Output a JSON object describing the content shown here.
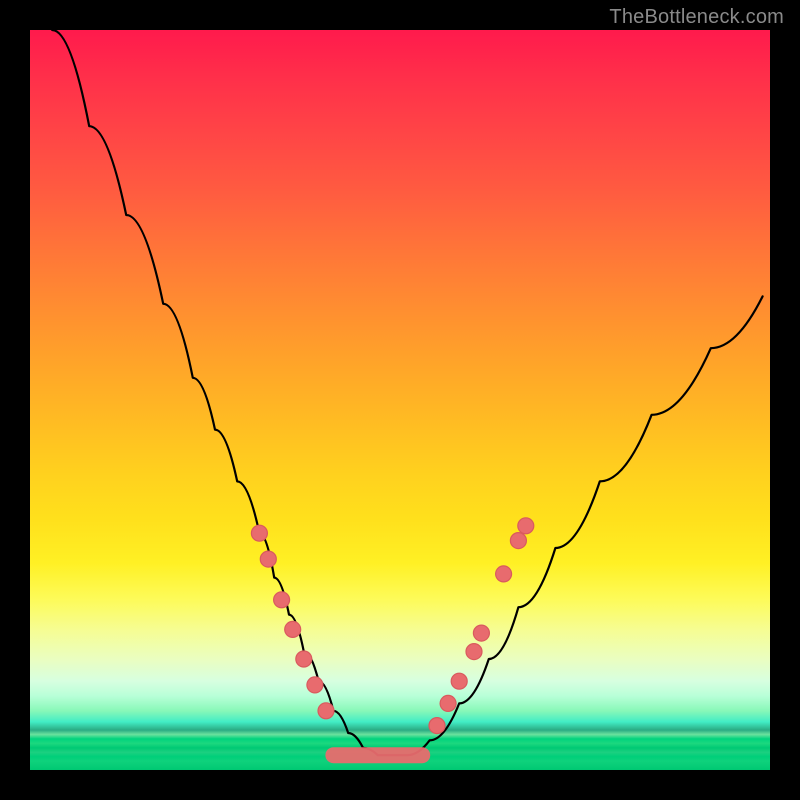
{
  "watermark": "TheBottleneck.com",
  "colors": {
    "frame": "#000000",
    "curve": "#000000",
    "marker": "#e86b6e",
    "gradient_top": "#ff1a4c",
    "gradient_mid": "#ffe01c",
    "gradient_bottom": "#00c873"
  },
  "chart_data": {
    "type": "line",
    "title": "",
    "xlabel": "",
    "ylabel": "",
    "xlim": [
      0,
      100
    ],
    "ylim": [
      0,
      100
    ],
    "grid": false,
    "legend": false,
    "series": [
      {
        "name": "bottleneck-curve",
        "x": [
          3,
          8,
          13,
          18,
          22,
          25,
          28,
          31,
          33,
          35,
          37,
          39,
          41,
          43,
          45,
          47,
          49,
          51,
          54,
          58,
          62,
          66,
          71,
          77,
          84,
          92,
          99
        ],
        "y": [
          100,
          87,
          75,
          63,
          53,
          46,
          39,
          32,
          26,
          21,
          16,
          12,
          8,
          5,
          3,
          2,
          2,
          2,
          4,
          9,
          15,
          22,
          30,
          39,
          48,
          57,
          64
        ]
      }
    ],
    "markers_left": [
      {
        "x": 31.0,
        "y": 32.0
      },
      {
        "x": 32.2,
        "y": 28.5
      },
      {
        "x": 34.0,
        "y": 23.0
      },
      {
        "x": 35.5,
        "y": 19.0
      },
      {
        "x": 37.0,
        "y": 15.0
      },
      {
        "x": 38.5,
        "y": 11.5
      },
      {
        "x": 40.0,
        "y": 8.0
      }
    ],
    "markers_right": [
      {
        "x": 55.0,
        "y": 6.0
      },
      {
        "x": 56.5,
        "y": 9.0
      },
      {
        "x": 58.0,
        "y": 12.0
      },
      {
        "x": 60.0,
        "y": 16.0
      },
      {
        "x": 61.0,
        "y": 18.5
      },
      {
        "x": 64.0,
        "y": 26.5
      },
      {
        "x": 66.0,
        "y": 31.0
      },
      {
        "x": 67.0,
        "y": 33.0
      }
    ],
    "flat_segment": {
      "x_start": 41,
      "x_end": 53,
      "y": 2
    }
  }
}
